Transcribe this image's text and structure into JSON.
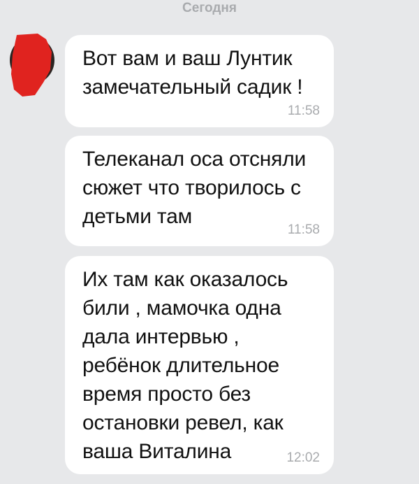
{
  "chat": {
    "date_divider": "Сегодня",
    "messages": [
      {
        "text": "Вот вам и ваш Лунтик\nзамечательный садик !",
        "time": "11:58"
      },
      {
        "text": "Телеканал оса отсняли\nсюжет что творилось с\nдетьми там",
        "time": "11:58"
      },
      {
        "text": "Их там как оказалось\nбили , мамочка одна\nдала интервью ,\nребёнок длительное\nвремя просто без\nостановки ревел, как\nваша Виталина",
        "time": "12:02"
      }
    ]
  },
  "colors": {
    "background": "#e7e8ea",
    "bubble": "#ffffff",
    "text": "#111111",
    "meta_text": "#a9abae",
    "avatar_redaction": "#e0231f"
  }
}
